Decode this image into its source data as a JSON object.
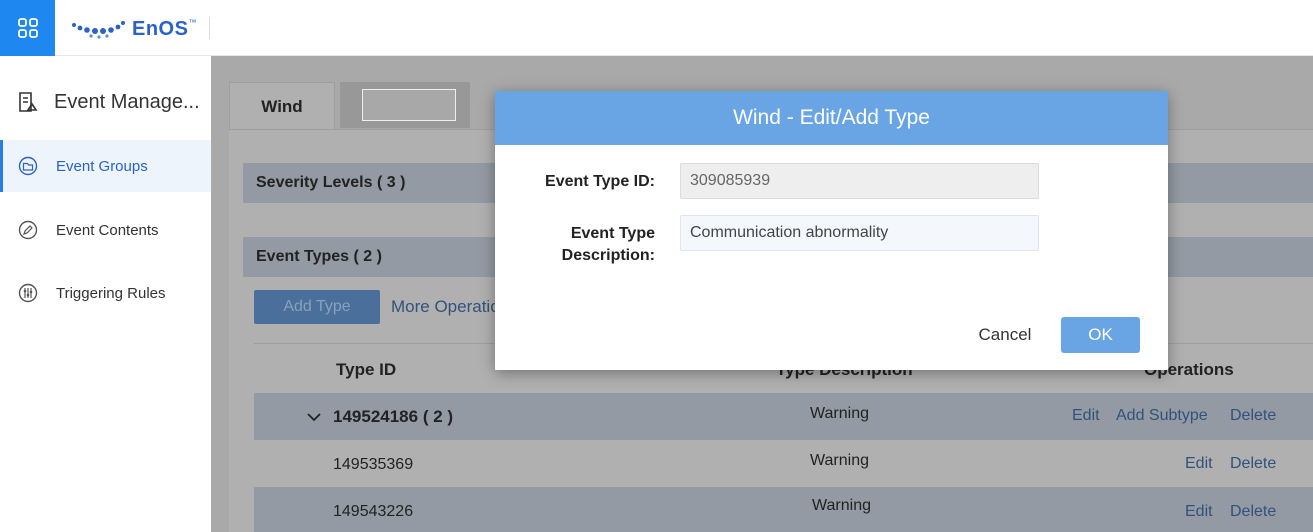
{
  "header": {
    "brand": "EnOS",
    "brand_tm": "™",
    "apps_icon": "grid-icon"
  },
  "sidebar": {
    "title": "Event Manage...",
    "title_icon": "report-icon",
    "items": [
      {
        "label": "Event Groups",
        "icon": "folder-icon",
        "active": true
      },
      {
        "label": "Event Contents",
        "icon": "edit-icon",
        "active": false
      },
      {
        "label": "Triggering Rules",
        "icon": "sliders-icon",
        "active": false
      }
    ]
  },
  "main": {
    "tabs": [
      {
        "label": "Wind"
      },
      {
        "label": ""
      }
    ],
    "severity_section": "Severity Levels ( 3 )",
    "types_section": "Event Types ( 2 )",
    "add_type_label": "Add Type",
    "more_operations_label": "More Operations",
    "table": {
      "headers": [
        "Type ID",
        "Type Description",
        "Operations"
      ],
      "rows": [
        {
          "id": "149524186 ( 2 )",
          "description": "Warning",
          "ops": [
            "Edit",
            "Add Subtype",
            "Delete"
          ],
          "expanded": true
        },
        {
          "id": "149535369",
          "description": "Warning",
          "ops": [
            "Edit",
            "Delete"
          ]
        },
        {
          "id": "149543226",
          "description": "Warning",
          "ops": [
            "Edit",
            "Delete"
          ]
        }
      ]
    }
  },
  "modal": {
    "title": "Wind - Edit/Add Type",
    "id_label": "Event Type ID:",
    "id_value": "309085939",
    "desc_label_line1": "Event Type",
    "desc_label_line2": "Description:",
    "desc_value": "Communication abnormality",
    "cancel_label": "Cancel",
    "ok_label": "OK"
  },
  "colors": {
    "accent": "#1e88f0",
    "modal_header": "#69a4e4",
    "link": "#2a62c9"
  }
}
